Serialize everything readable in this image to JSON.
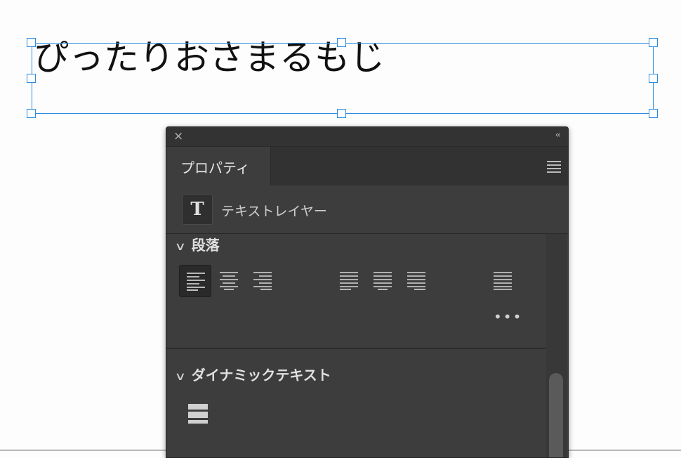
{
  "canvas": {
    "text": "ぴったりおさまるもじ",
    "selection_color": "#2a8be0"
  },
  "panel": {
    "close_icon": "×",
    "collapse_icon": "‹‹",
    "tab_label": "プロパティ",
    "layer_type_icon": "T",
    "layer_type_label": "テキストレイヤー",
    "paragraph": {
      "title": "段落",
      "alignment_buttons": [
        "align-left",
        "align-center",
        "align-right",
        "justify-last-left",
        "justify-last-center",
        "justify-last-right",
        "justify-all"
      ],
      "selected": "align-left",
      "more_icon": "•••"
    },
    "dynamic_text": {
      "title": "ダイナミックテキスト"
    }
  }
}
